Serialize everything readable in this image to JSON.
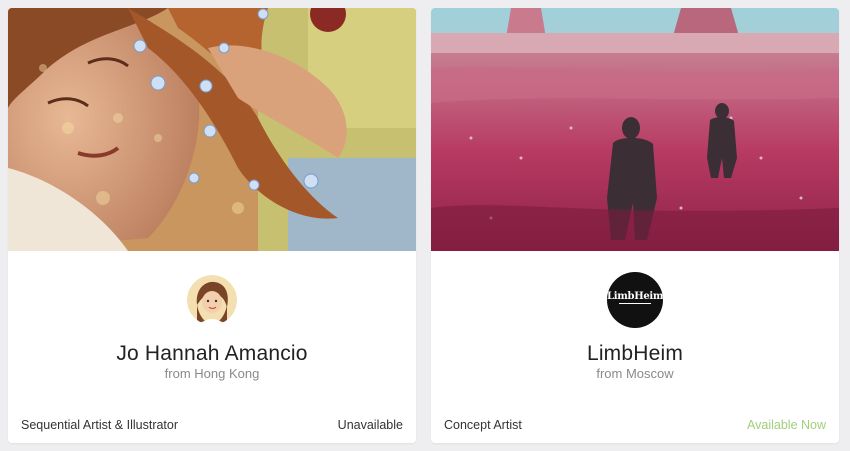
{
  "cards": [
    {
      "name": "Jo Hannah Amancio",
      "location": "from Hong Kong",
      "role": "Sequential Artist & Illustrator",
      "availability": "Unavailable",
      "availability_color": "#333333",
      "cover_icon": "illustration-girl-with-flowers",
      "avatar_icon": "avatar-illustrated-girl"
    },
    {
      "name": "LimbHeim",
      "location": "from Moscow",
      "role": "Concept Artist",
      "availability": "Available Now",
      "availability_color": "#a3cf7a",
      "cover_icon": "painting-pink-field-figures",
      "avatar_icon": "avatar-limbheim-logo",
      "avatar_logo_text": "LimbHeim"
    }
  ]
}
